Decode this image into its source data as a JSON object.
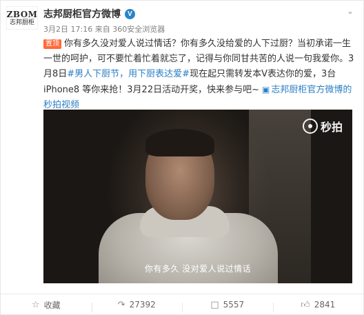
{
  "author": {
    "avatar_line1": "ZBOM",
    "avatar_line2": "志邦厨柜",
    "name": "志邦厨柜官方微博",
    "verified_badge": "V"
  },
  "meta": {
    "time": "3月2日 17:16",
    "source_prefix": "来自",
    "source": "360安全浏览器"
  },
  "post": {
    "pin_label": "置顶",
    "text_1": "你有多久没对爱人说过情话？你有多久没给爱的人下过厨？当初承诺一生一世的呵护，可不要忙着忙着就忘了，记得与你同甘共苦的人说一句我爱你。3月8日",
    "hashtag_1": "#男人下厨节，用下厨表达爱#",
    "text_2": "现在起只需转发本V表达你的爱，3台iPhone8 等你来抢！3月22日活动开奖，快来参与吧~",
    "video_link": "志邦厨柜官方微博的秒拍视频"
  },
  "video": {
    "watermark": "秒拍",
    "subtitle": "你有多久  没对爱人说过情话"
  },
  "actions": {
    "favorite_label": "收藏",
    "repost_count": "27392",
    "comment_count": "5557",
    "like_count": "2841"
  }
}
